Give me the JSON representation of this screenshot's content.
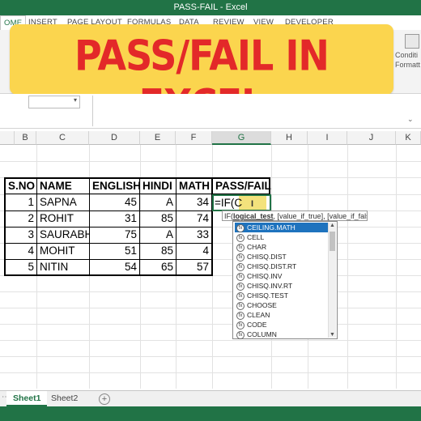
{
  "window": {
    "title": "PASS-FAIL - Excel"
  },
  "menu": [
    "OME",
    "INSERT",
    "PAGE LAYOUT",
    "FORMULAS",
    "DATA",
    "REVIEW",
    "VIEW",
    "DEVELOPER"
  ],
  "banner": {
    "text": "PASS/FAIL IN EXCEL"
  },
  "ribbon": {
    "conditional_line1": "Conditi",
    "conditional_line2": "Formatt"
  },
  "columns": [
    "B",
    "C",
    "D",
    "E",
    "F",
    "G",
    "H",
    "I",
    "J",
    "K"
  ],
  "table": {
    "headers": [
      "S.NO",
      "NAME",
      "ENGLISH",
      "HINDI",
      "MATH",
      "PASS/FAIL"
    ],
    "rows": [
      [
        "1",
        "SAPNA",
        "45",
        "A",
        "34"
      ],
      [
        "2",
        "ROHIT",
        "31",
        "85",
        "74"
      ],
      [
        "3",
        "SAURABH",
        "75",
        "A",
        "33"
      ],
      [
        "4",
        "MOHIT",
        "51",
        "85",
        "4"
      ],
      [
        "5",
        "NITIN",
        "54",
        "65",
        "57"
      ]
    ]
  },
  "formula": {
    "text": "=IF(C"
  },
  "tooltip": {
    "fn": "IF(",
    "arg": "logical_test",
    "rest": ", [value_if_true], [value_if_false])"
  },
  "autocomplete": [
    "CEILING.MATH",
    "CELL",
    "CHAR",
    "CHISQ.DIST",
    "CHISQ.DIST.RT",
    "CHISQ.INV",
    "CHISQ.INV.RT",
    "CHISQ.TEST",
    "CHOOSE",
    "CLEAN",
    "CODE",
    "COLUMN"
  ],
  "sheets": [
    "Sheet1",
    "Sheet2"
  ],
  "colors": {
    "excel_green": "#217346",
    "banner_bg": "#fbd54e",
    "banner_text": "#e32929",
    "selection_blue": "#1e73be"
  }
}
